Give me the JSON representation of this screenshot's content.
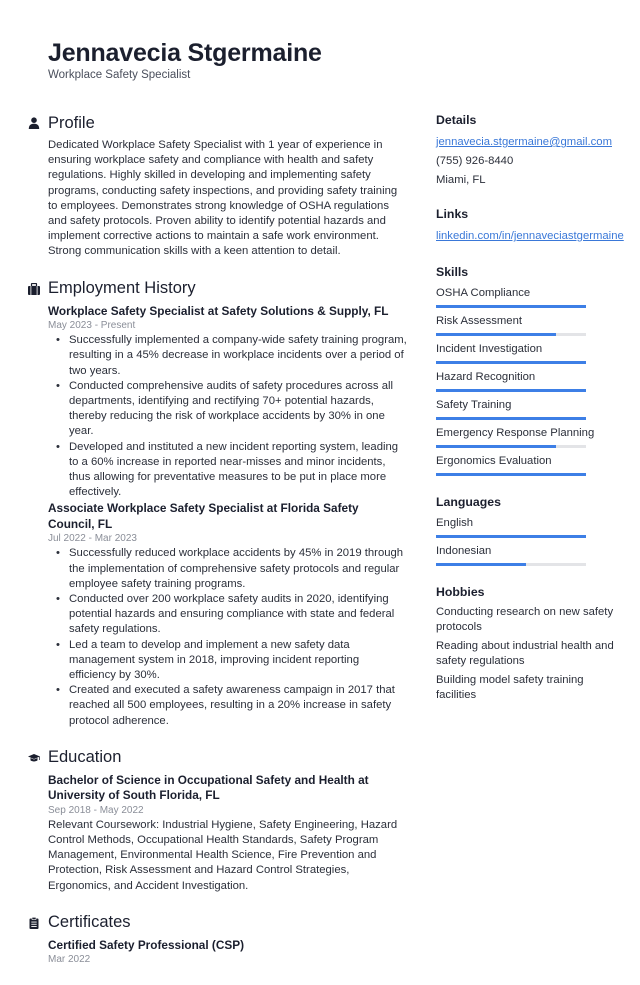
{
  "header": {
    "name": "Jennavecia Stgermaine",
    "title": "Workplace Safety Specialist"
  },
  "profile": {
    "heading": "Profile",
    "icon": "person-icon",
    "text": "Dedicated Workplace Safety Specialist with 1 year of experience in ensuring workplace safety and compliance with health and safety regulations. Highly skilled in developing and implementing safety programs, conducting safety inspections, and providing safety training to employees. Demonstrates strong knowledge of OSHA regulations and safety protocols. Proven ability to identify potential hazards and implement corrective actions to maintain a safe work environment. Strong communication skills with a keen attention to detail."
  },
  "employment": {
    "heading": "Employment History",
    "icon": "briefcase-icon",
    "jobs": [
      {
        "title": "Workplace Safety Specialist at Safety Solutions & Supply, FL",
        "dates": "May 2023 - Present",
        "bullets": [
          "Successfully implemented a company-wide safety training program, resulting in a 45% decrease in workplace incidents over a period of two years.",
          "Conducted comprehensive audits of safety procedures across all departments, identifying and rectifying 70+ potential hazards, thereby reducing the risk of workplace accidents by 30% in one year.",
          "Developed and instituted a new incident reporting system, leading to a 60% increase in reported near-misses and minor incidents, thus allowing for preventative measures to be put in place more effectively."
        ]
      },
      {
        "title": "Associate Workplace Safety Specialist at Florida Safety Council, FL",
        "dates": "Jul 2022 - Mar 2023",
        "bullets": [
          "Successfully reduced workplace accidents by 45% in 2019 through the implementation of comprehensive safety protocols and regular employee safety training programs.",
          "Conducted over 200 workplace safety audits in 2020, identifying potential hazards and ensuring compliance with state and federal safety regulations.",
          "Led a team to develop and implement a new safety data management system in 2018, improving incident reporting efficiency by 30%.",
          "Created and executed a safety awareness campaign in 2017 that reached all 500 employees, resulting in a 20% increase in safety protocol adherence."
        ]
      }
    ]
  },
  "education": {
    "heading": "Education",
    "icon": "graduation-cap-icon",
    "degree": "Bachelor of Science in Occupational Safety and Health at University of South Florida, FL",
    "dates": "Sep 2018 - May 2022",
    "description": "Relevant Coursework: Industrial Hygiene, Safety Engineering, Hazard Control Methods, Occupational Health Standards, Safety Program Management, Environmental Health Science, Fire Prevention and Protection, Risk Assessment and Hazard Control Strategies, Ergonomics, and Accident Investigation."
  },
  "certificates": {
    "heading": "Certificates",
    "icon": "clipboard-icon",
    "items": [
      {
        "name": "Certified Safety Professional (CSP)",
        "date": "Mar 2022"
      }
    ]
  },
  "details": {
    "heading": "Details",
    "email": "jennavecia.stgermaine@gmail.com",
    "phone": "(755) 926-8440",
    "location": "Miami, FL"
  },
  "links": {
    "heading": "Links",
    "items": [
      "linkedin.com/in/jennaveciastgermaine"
    ]
  },
  "skills": {
    "heading": "Skills",
    "items": [
      {
        "name": "OSHA Compliance",
        "level": 1.0
      },
      {
        "name": "Risk Assessment",
        "level": 0.8
      },
      {
        "name": "Incident Investigation",
        "level": 1.0
      },
      {
        "name": "Hazard Recognition",
        "level": 1.0
      },
      {
        "name": "Safety Training",
        "level": 1.0
      },
      {
        "name": "Emergency Response Planning",
        "level": 0.8
      },
      {
        "name": "Ergonomics Evaluation",
        "level": 1.0
      }
    ]
  },
  "languages": {
    "heading": "Languages",
    "items": [
      {
        "name": "English",
        "level": 1.0
      },
      {
        "name": "Indonesian",
        "level": 0.6
      }
    ]
  },
  "hobbies": {
    "heading": "Hobbies",
    "items": [
      "Conducting research on new safety protocols",
      "Reading about industrial health and safety regulations",
      "Building model safety training facilities"
    ]
  },
  "colors": {
    "accent": "#3d7fe6",
    "track": "#e3e4e7",
    "link": "#3a78d8"
  }
}
